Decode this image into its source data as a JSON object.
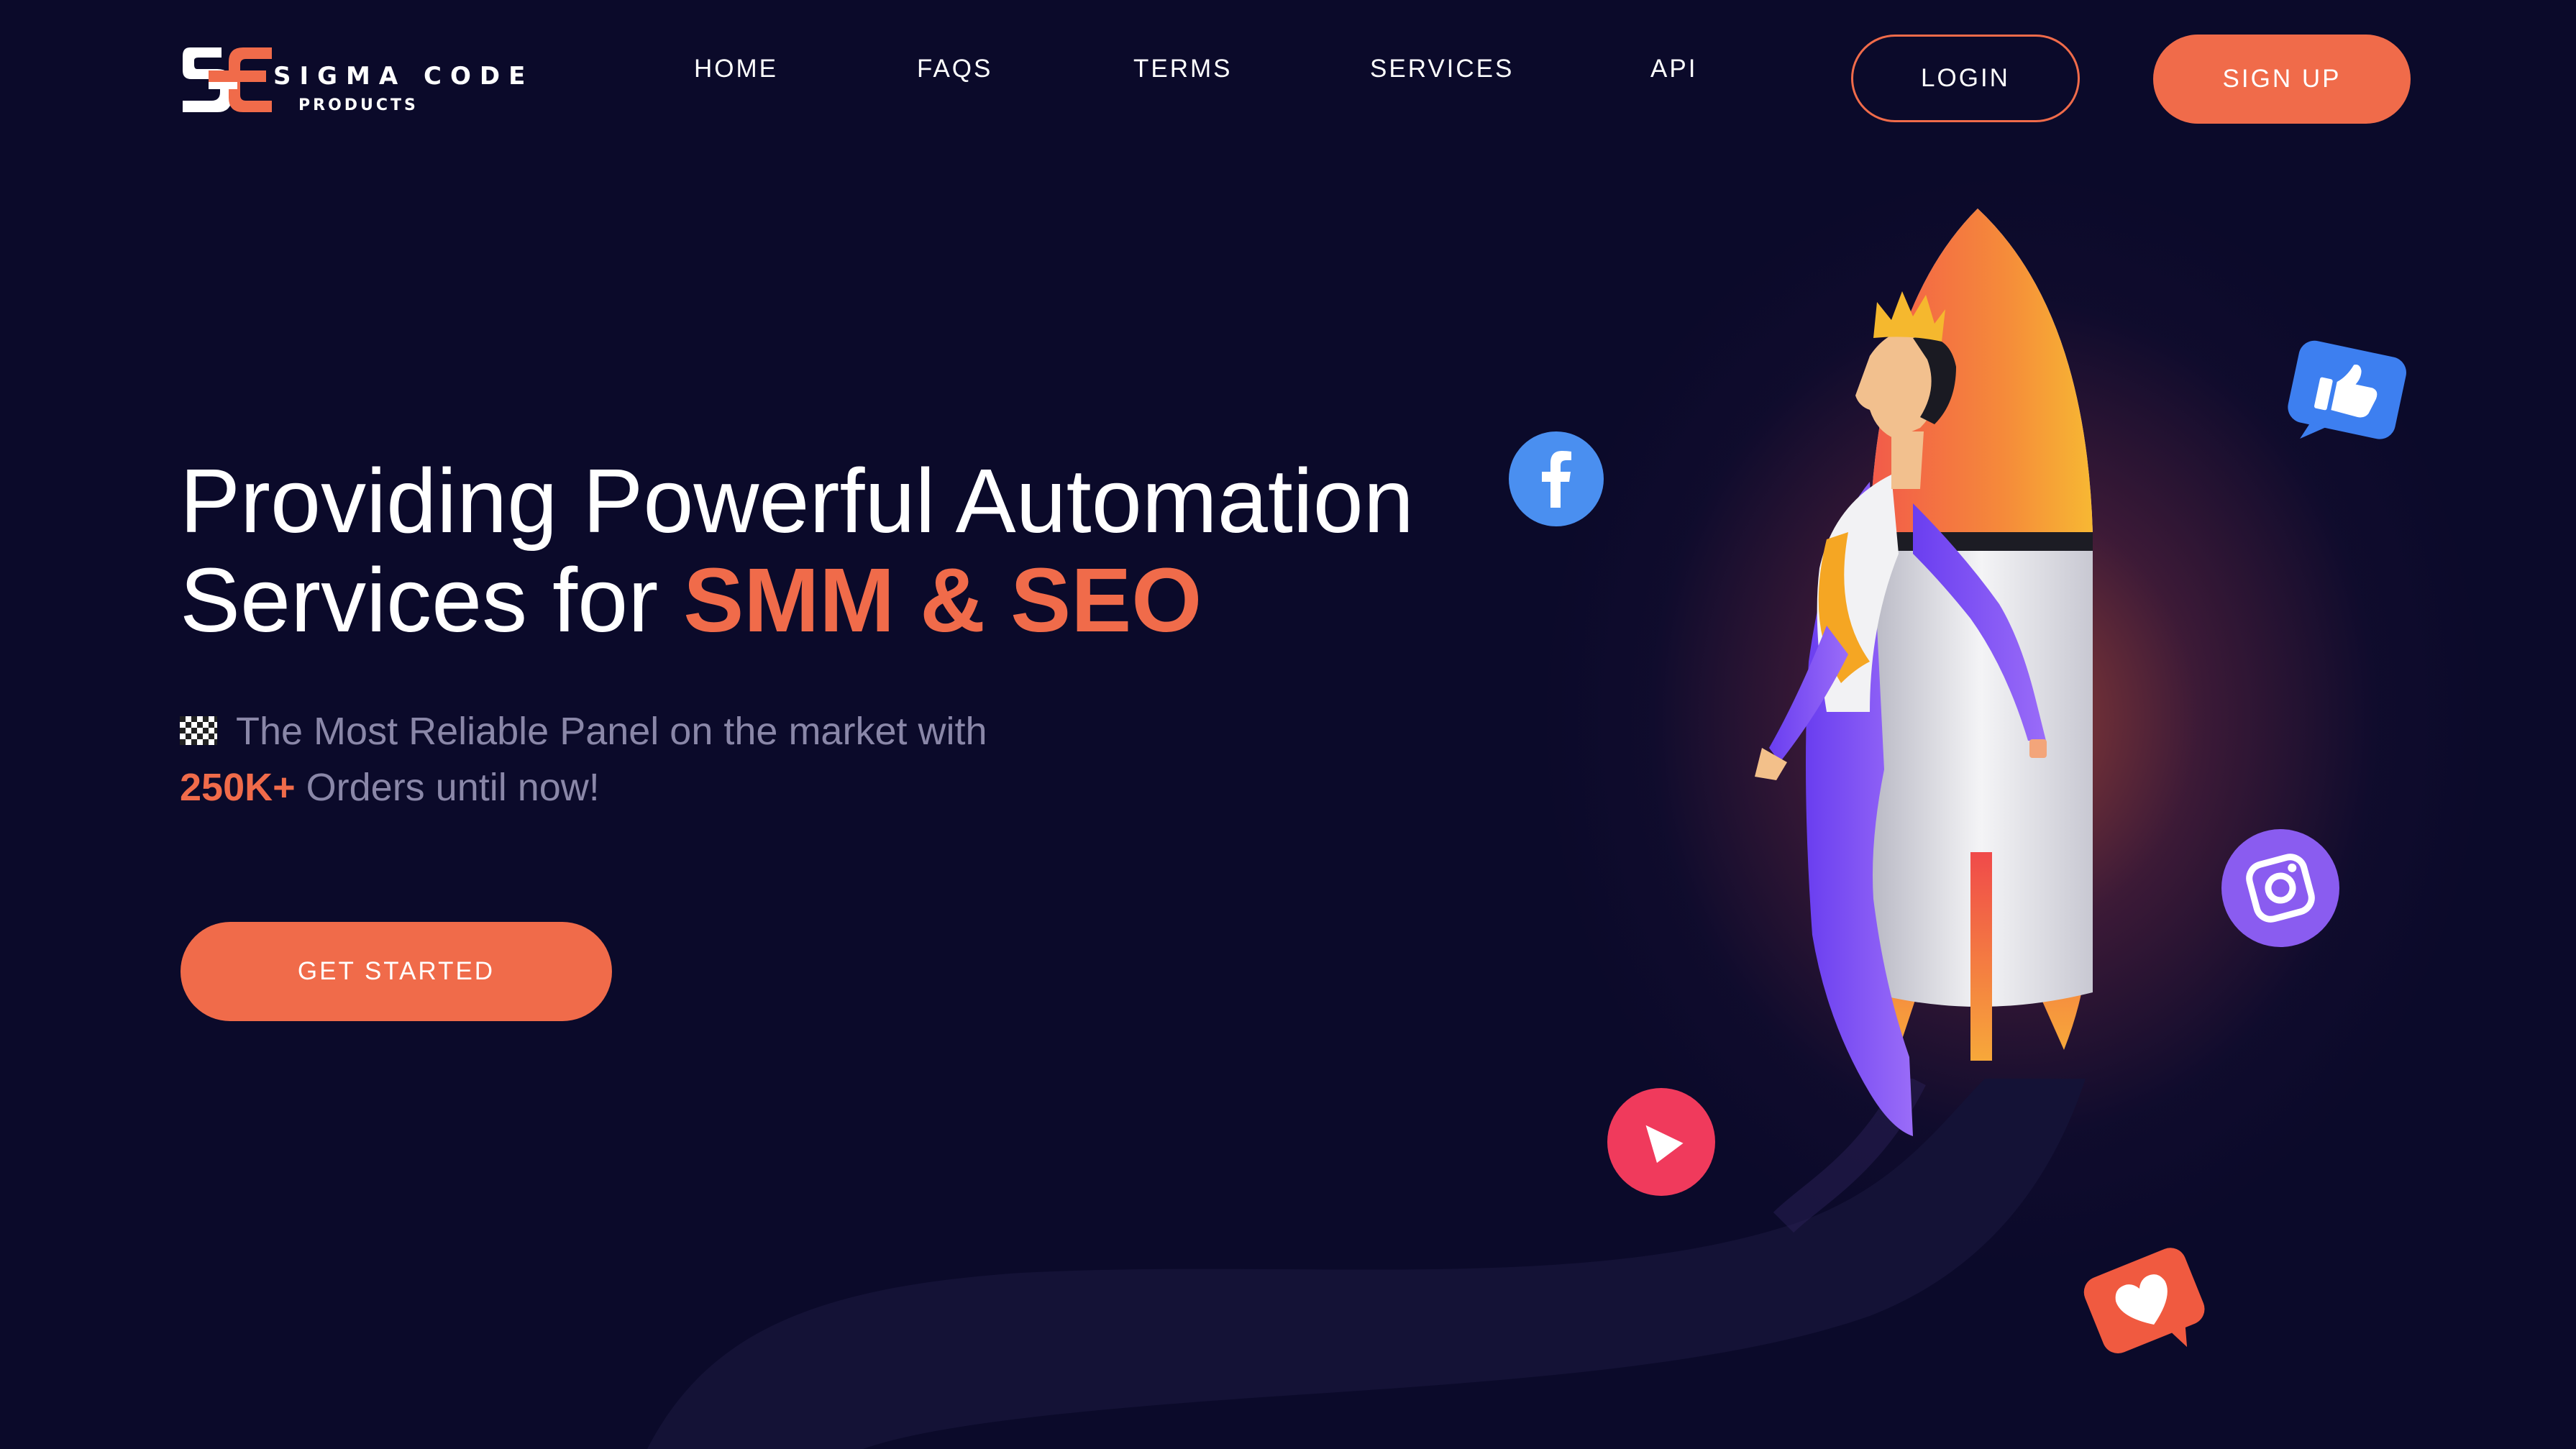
{
  "brand": {
    "logo_letters": "SC",
    "name": "SIGMA CODE",
    "sub": "PRODUCTS"
  },
  "nav": {
    "home": "HOME",
    "faqs": "FAQS",
    "terms": "TERMS",
    "services": "SERVICES",
    "api": "API"
  },
  "auth": {
    "login": "LOGIN",
    "signup": "SIGN UP"
  },
  "hero": {
    "title_line1": "Providing Powerful Automation",
    "title_line2_prefix": "Services for ",
    "title_line2_accent": "SMM & SEO",
    "tagline_line1": "The Most Reliable Panel on the market with",
    "orders_count": "250K+",
    "tagline_line2_suffix": " Orders until now!",
    "cta": "GET STARTED"
  },
  "icons": {
    "tagline": "checkered-flag-icon",
    "social": [
      "facebook-icon",
      "thumbs-up-icon",
      "instagram-icon",
      "play-icon",
      "heart-icon"
    ]
  },
  "colors": {
    "background": "#0b0a2a",
    "accent": "#f06b4a",
    "muted_text": "#8a87a8",
    "facebook": "#4a8ff0",
    "like": "#3d7ff0",
    "instagram": "#8a5cf0",
    "play": "#f03a5c",
    "heart": "#f05a40"
  }
}
